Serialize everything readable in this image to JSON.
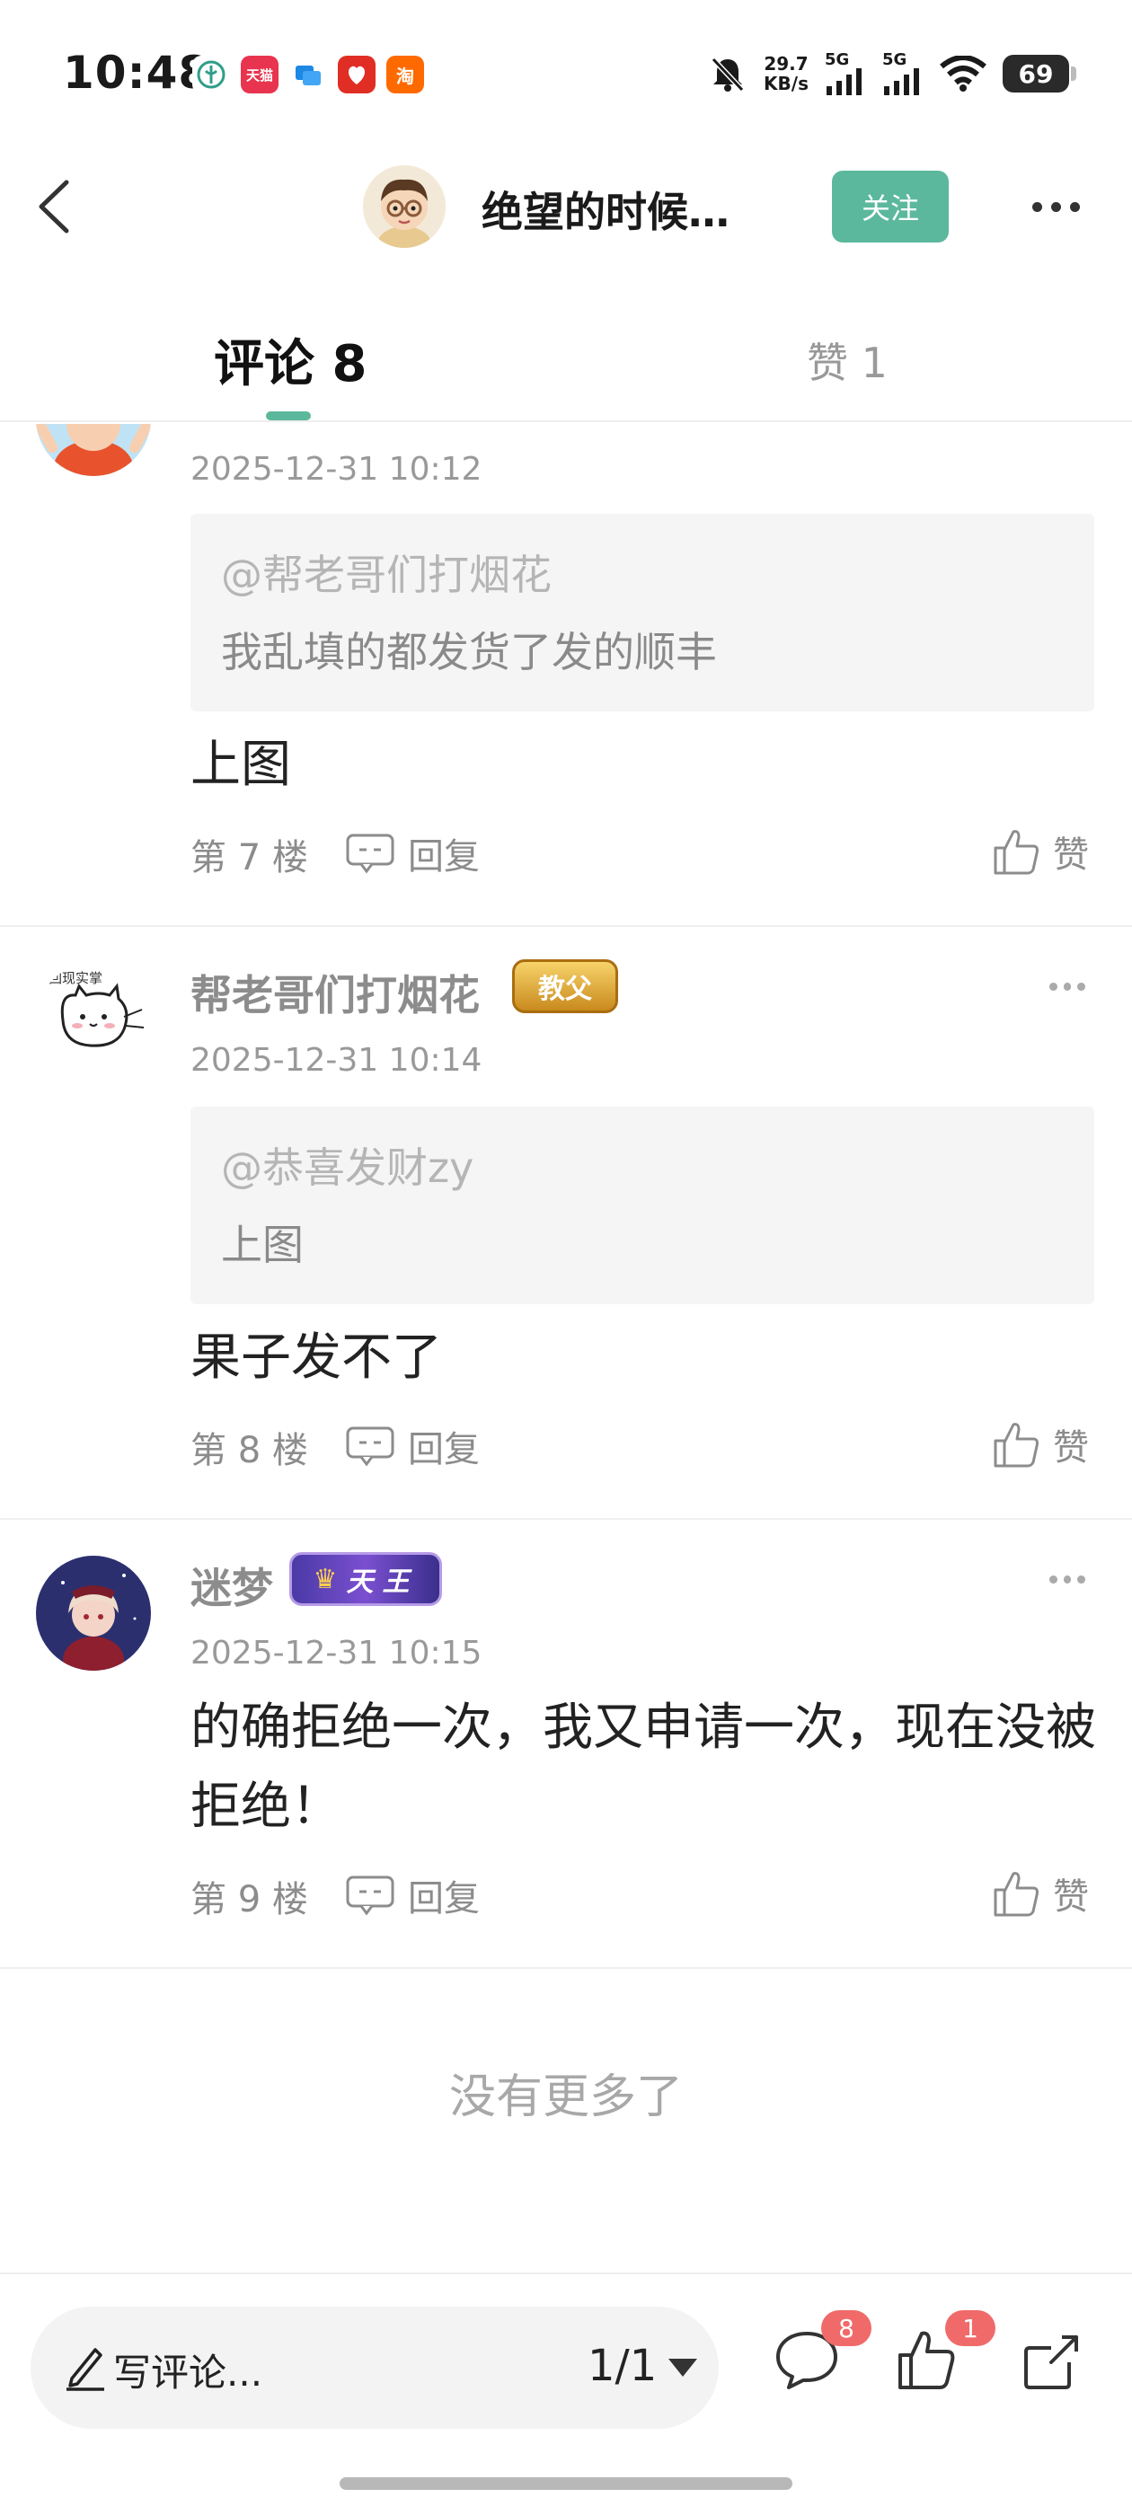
{
  "status": {
    "time": "10:48",
    "net_speed_value": "29.7",
    "net_speed_unit": "KB/s",
    "sig1": "5G",
    "sig2": "5G",
    "battery": "69",
    "apps": [
      {
        "name": "tmall",
        "label": "天猫",
        "color": "#e8344e"
      },
      {
        "name": "taobao",
        "label": "淘",
        "color": "#ff6a00"
      }
    ]
  },
  "nav": {
    "title": "绝望的时候…",
    "follow": "关注"
  },
  "tabs": {
    "comments": "评论 8",
    "likes": "赞 1"
  },
  "comments": [
    {
      "time": "2025-12-31 10:12",
      "quote_mention": "@帮老哥们打烟花",
      "quote_text": "我乱填的都发货了发的顺丰",
      "body": "上图",
      "floor": "第 7 楼",
      "reply": "回复",
      "like": "赞"
    },
    {
      "name": "帮老哥们打烟花",
      "badge": "教父",
      "avatar_caption": "回现实掌",
      "time": "2025-12-31 10:14",
      "quote_mention": "@恭喜发财zy",
      "quote_text": "上图",
      "body": "果子发不了",
      "floor": "第 8 楼",
      "reply": "回复",
      "like": "赞"
    },
    {
      "name": "迷梦",
      "badge": "天王",
      "time": "2025-12-31 10:15",
      "body": "的确拒绝一次，我又申请一次，现在没被拒绝！",
      "floor": "第 9 楼",
      "reply": "回复",
      "like": "赞"
    }
  ],
  "no_more": "没有更多了",
  "bottom": {
    "write": "写评论...",
    "page": "1/1",
    "comment_count": "8",
    "like_count": "1"
  },
  "colors": {
    "accent": "#5cb89c",
    "badge_red": "#f06a6a"
  }
}
